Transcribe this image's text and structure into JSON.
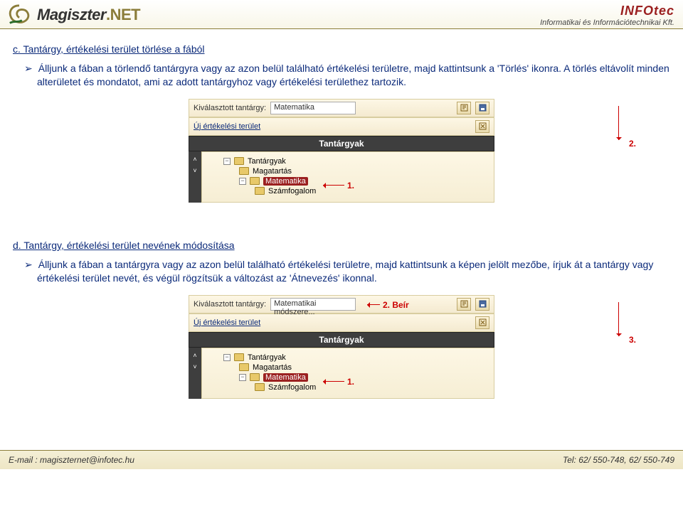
{
  "header": {
    "logo_main": "Magiszter",
    "logo_suffix": ".NET",
    "brand": "INFOtec",
    "subtitle": "Informatikai és Információtechnikai Kft."
  },
  "section_c": {
    "heading": "c. Tantárgy, értékelési terület törlése a fából",
    "text": "Álljunk a fában a törlendő tantárgyra vagy az azon belül található értékelési területre, majd kattintsunk a 'Törlés' ikonra. A törlés eltávolít minden alterületet és mondatot, ami az adott tantárgyhoz vagy értékelési területhez tartozik."
  },
  "section_d": {
    "heading": "d. Tantárgy, értékelési terület nevének módosítása",
    "text": "Álljunk a fában a tantárgyra vagy az azon belül található értékelési területre, majd kattintsunk a képen jelölt mezőbe, írjuk át a tantárgy vagy értékelési terület nevét, és végül rögzítsük a változást az 'Átnevezés' ikonnal."
  },
  "ui1": {
    "selected_label": "Kiválasztott tantárgy:",
    "selected_value": "Matematika",
    "new_label": "Új értékelési terület",
    "bar": "Tantárgyak",
    "tree": {
      "root": "Tantárgyak",
      "n1": "Magatartás",
      "n2": "Matematika",
      "n3": "Számfogalom"
    },
    "callout1": "1.",
    "callout2": "2."
  },
  "ui2": {
    "selected_label": "Kiválasztott tantárgy:",
    "selected_value": "Matematikai módszere...",
    "new_label": "Új értékelési terület",
    "bar": "Tantárgyak",
    "tree": {
      "root": "Tantárgyak",
      "n1": "Magatartás",
      "n2": "Matematika",
      "n3": "Számfogalom"
    },
    "callout1": "1.",
    "callout2": "2. Beír",
    "callout3": "3."
  },
  "footer": {
    "email_label": "E-mail : ",
    "email": "magiszternet@infotec.hu",
    "tel_label": "Tel: ",
    "tel": "62/ 550-748, 62/ 550-749"
  },
  "icons": {
    "rename": "rename-icon",
    "save": "save-icon",
    "delete": "delete-icon",
    "up": "expand-up-icon",
    "down": "expand-down-icon"
  }
}
